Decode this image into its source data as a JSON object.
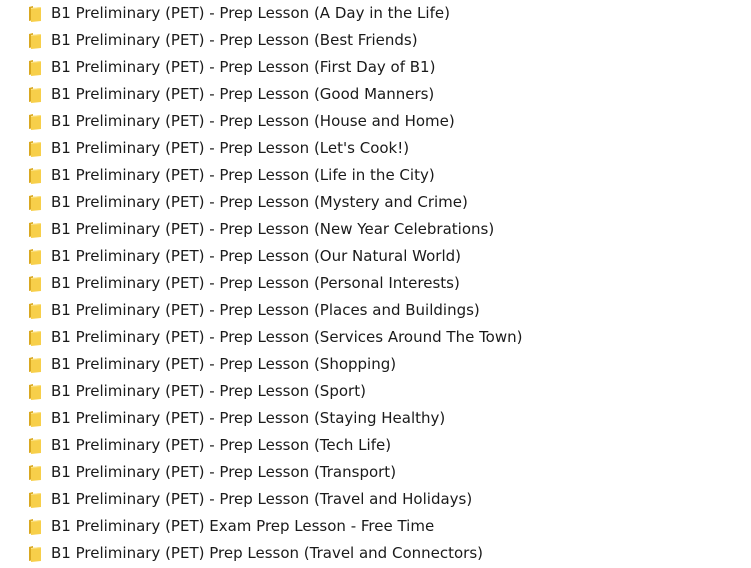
{
  "folder_color": "#f7cf4a",
  "folder_shadow": "#d9a821",
  "icon": "folder-icon",
  "items": [
    {
      "label": "B1 Preliminary (PET) - Prep Lesson (A Day in the Life)"
    },
    {
      "label": "B1 Preliminary (PET) - Prep Lesson (Best Friends)"
    },
    {
      "label": "B1 Preliminary (PET) - Prep Lesson (First Day of B1)"
    },
    {
      "label": "B1 Preliminary (PET) - Prep Lesson (Good Manners)"
    },
    {
      "label": "B1 Preliminary (PET) - Prep Lesson (House and Home)"
    },
    {
      "label": "B1 Preliminary (PET) - Prep Lesson (Let's Cook!)"
    },
    {
      "label": "B1 Preliminary (PET) - Prep Lesson (Life in the City)"
    },
    {
      "label": "B1 Preliminary (PET) - Prep Lesson (Mystery and Crime)"
    },
    {
      "label": "B1 Preliminary (PET) - Prep Lesson (New Year Celebrations)"
    },
    {
      "label": "B1 Preliminary (PET) - Prep Lesson (Our Natural World)"
    },
    {
      "label": "B1 Preliminary (PET) - Prep Lesson (Personal Interests)"
    },
    {
      "label": "B1 Preliminary (PET) - Prep Lesson (Places and Buildings)"
    },
    {
      "label": "B1 Preliminary (PET) - Prep Lesson (Services Around The Town)"
    },
    {
      "label": "B1 Preliminary (PET) - Prep Lesson (Shopping)"
    },
    {
      "label": "B1 Preliminary (PET) - Prep Lesson (Sport)"
    },
    {
      "label": "B1 Preliminary (PET) - Prep Lesson (Staying Healthy)"
    },
    {
      "label": "B1 Preliminary (PET) - Prep Lesson (Tech Life)"
    },
    {
      "label": "B1 Preliminary (PET) - Prep Lesson (Transport)"
    },
    {
      "label": "B1 Preliminary (PET) - Prep Lesson (Travel and Holidays)"
    },
    {
      "label": "B1 Preliminary (PET) Exam Prep Lesson - Free Time"
    },
    {
      "label": "B1 Preliminary (PET) Prep Lesson (Travel and Connectors)"
    }
  ]
}
